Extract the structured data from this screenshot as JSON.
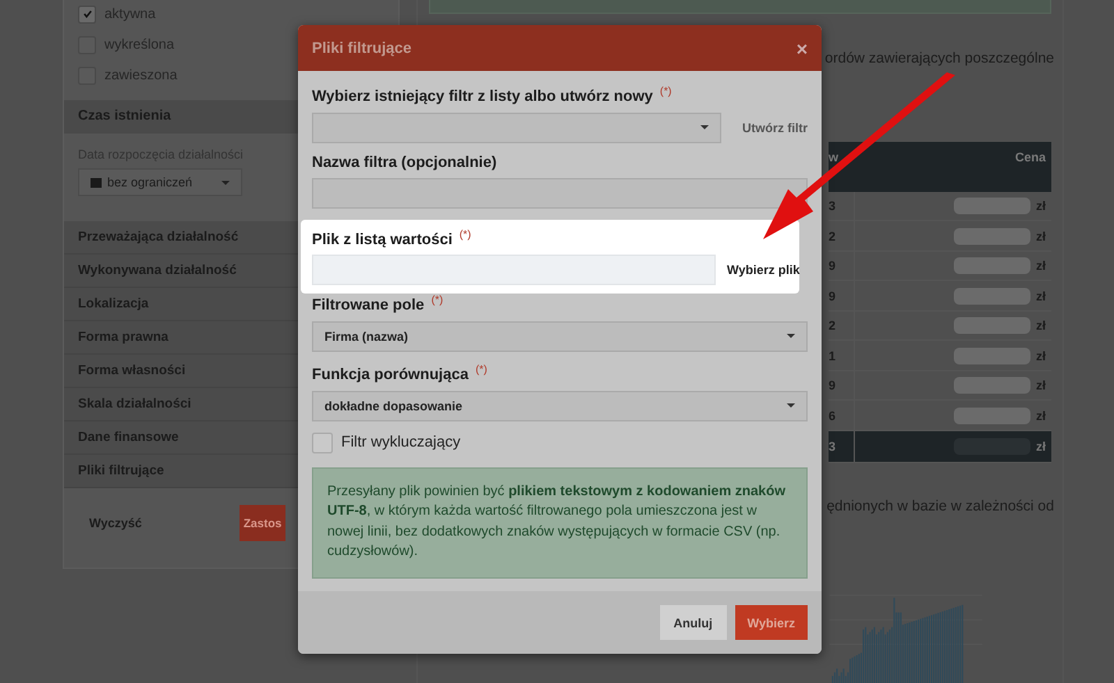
{
  "sidebar": {
    "status_options": [
      {
        "label": "aktywna",
        "checked": true
      },
      {
        "label": "wykreślona",
        "checked": false
      },
      {
        "label": "zawieszona",
        "checked": false
      }
    ],
    "time_section": {
      "title": "Czas istnienia",
      "field_label": "Data rozpoczęcia działalności",
      "dropdown_value": "bez ograniczeń"
    },
    "sections": [
      "Przeważająca działalność",
      "Wykonywana działalność",
      "Lokalizacja",
      "Forma prawna",
      "Forma własności",
      "Skala działalności",
      "Dane finansowe",
      "Pliki filtrujące"
    ],
    "clear_button": "Wyczyść",
    "apply_button": "Zastos"
  },
  "background": {
    "text_1": "ordów zawierających poszczególne",
    "table": {
      "column_1": "w",
      "column_2": "Cena",
      "rows": [
        {
          "count": "3",
          "currency": "zł"
        },
        {
          "count": "2",
          "currency": "zł"
        },
        {
          "count": "9",
          "currency": "zł"
        },
        {
          "count": "9",
          "currency": "zł"
        },
        {
          "count": "2",
          "currency": "zł"
        },
        {
          "count": "1",
          "currency": "zł"
        },
        {
          "count": "9",
          "currency": "zł"
        },
        {
          "count": "6",
          "currency": "zł"
        }
      ],
      "total": {
        "count": "3",
        "currency": "zł"
      }
    },
    "text_2": "ędnionych w bazie w zależności od"
  },
  "modal": {
    "title": "Pliki filtrujące",
    "close": "×",
    "fields": [
      {
        "kind": "select",
        "label": "Wybierz istniejący filtr z listy albo utwórz nowy",
        "required": "(*)",
        "action": "Utwórz filtr",
        "highlighted": false
      },
      {
        "kind": "text",
        "label": "Nazwa filtra (opcjonalnie)",
        "highlighted": false
      },
      {
        "kind": "file",
        "label": "Plik z listą wartości",
        "required": "(*)",
        "button": "Wybierz plik",
        "highlighted": true
      },
      {
        "kind": "select",
        "label": "Filtrowane pole",
        "required": "(*)",
        "value": "Firma (nazwa)",
        "highlighted": false
      },
      {
        "kind": "select",
        "label": "Funkcja porównująca",
        "required": "(*)",
        "value": "dokładne dopasowanie",
        "highlighted": false
      }
    ],
    "checkbox": {
      "label": "Filtr wykluczający",
      "checked": false
    },
    "info": "Przesyłany plik powinien być **plikiem tekstowym z kodowaniem znaków UTF-8**, w którym każda wartość filtrowanego pola umieszczona jest w nowej linii, bez dodatkowych znaków występujących w formacie CSV (np. cudzysłowów).",
    "buttons": [
      {
        "label": "Anuluj",
        "kind": "secondary"
      },
      {
        "label": "Wybierz",
        "kind": "primary"
      }
    ]
  }
}
